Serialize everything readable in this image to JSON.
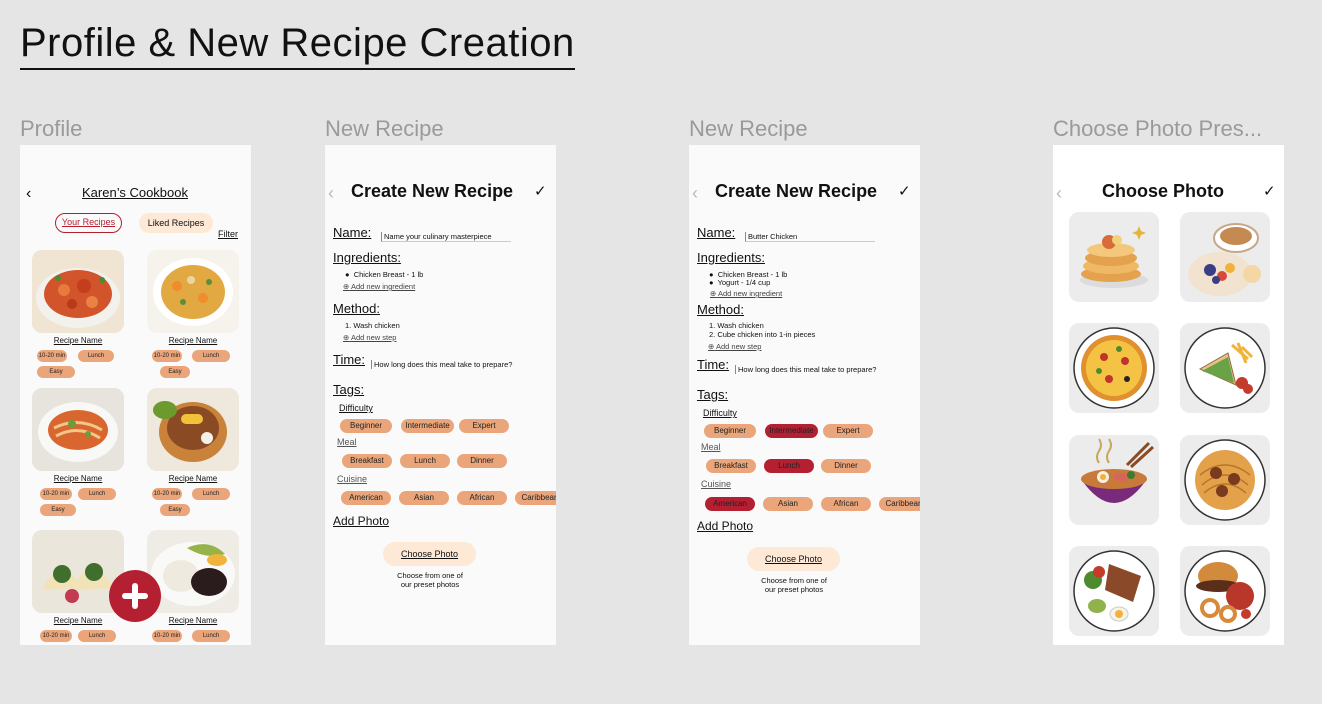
{
  "page_title": "Profile & New Recipe Creation",
  "frames": {
    "profile": {
      "label": "Profile",
      "title": "Karen’s Cookbook",
      "tab_your": "Your Recipes",
      "tab_liked": "Liked Recipes",
      "filter": "Filter",
      "recipe_name": "Recipe Name",
      "time_tag": "10-20 min",
      "meal_tag": "Lunch",
      "level_tag": "Easy",
      "add_icon": "plus-icon",
      "accent": "#b51f32"
    },
    "new_recipe_1": {
      "label": "New Recipe",
      "header": "Create New Recipe",
      "name_label": "Name:",
      "name_placeholder": "Name your culinary masterpiece",
      "ingredients_label": "Ingredients:",
      "ingredients": [
        "Chicken Breast - 1 lb"
      ],
      "add_ingredient": "Add new ingredient",
      "method_label": "Method:",
      "method": [
        "1. Wash chicken"
      ],
      "add_step": "Add new step",
      "time_label": "Time:",
      "time_placeholder": "How long does this meal take to prepare?",
      "tags_label": "Tags:",
      "difficulty_label": "Difficulty",
      "difficulty": [
        "Beginner",
        "Intermediate",
        "Expert"
      ],
      "meal_label": "Meal",
      "meal": [
        "Breakfast",
        "Lunch",
        "Dinner"
      ],
      "cuisine_label": "Cuisine",
      "cuisine": [
        "American",
        "Asian",
        "African",
        "Caribbean"
      ],
      "add_photo_label": "Add Photo",
      "choose_photo": "Choose Photo",
      "choose_hint_1": "Choose from one of",
      "choose_hint_2": "our preset photos"
    },
    "new_recipe_2": {
      "label": "New Recipe",
      "header": "Create New Recipe",
      "name_label": "Name:",
      "name_value": "Butter Chicken",
      "ingredients_label": "Ingredients:",
      "ingredients": [
        "Chicken Breast - 1 lb",
        "Yogurt - 1/4 cup"
      ],
      "add_ingredient": "Add new ingredient",
      "method_label": "Method:",
      "method": [
        "1. Wash chicken",
        "2. Cube chicken into 1-in pieces"
      ],
      "add_step": "Add new step",
      "time_label": "Time:",
      "time_placeholder": "How long does this meal take to prepare?",
      "tags_label": "Tags:",
      "difficulty_label": "Difficulty",
      "difficulty": [
        "Beginner",
        "Intermediate",
        "Expert"
      ],
      "meal_label": "Meal",
      "meal": [
        "Breakfast",
        "Lunch",
        "Dinner"
      ],
      "cuisine_label": "Cuisine",
      "cuisine": [
        "American",
        "Asian",
        "African",
        "Caribbean"
      ],
      "selected": [
        "Intermediate",
        "Lunch",
        "American"
      ],
      "add_photo_label": "Add Photo",
      "choose_photo": "Choose Photo",
      "choose_hint_1": "Choose from one of",
      "choose_hint_2": "our preset photos"
    },
    "choose_photo": {
      "label": "Choose Photo Pres...",
      "header": "Choose Photo",
      "presets": [
        "pancakes",
        "coffee-and-fruit",
        "pizza",
        "sandwich-and-fries",
        "ramen",
        "spaghetti",
        "steak-and-eggs",
        "burger"
      ]
    }
  },
  "colors": {
    "tag": "#eaa57a",
    "selected_tag": "#b51f32",
    "choose_button": "#fde9d6",
    "liked_tab": "#fde9d6"
  }
}
